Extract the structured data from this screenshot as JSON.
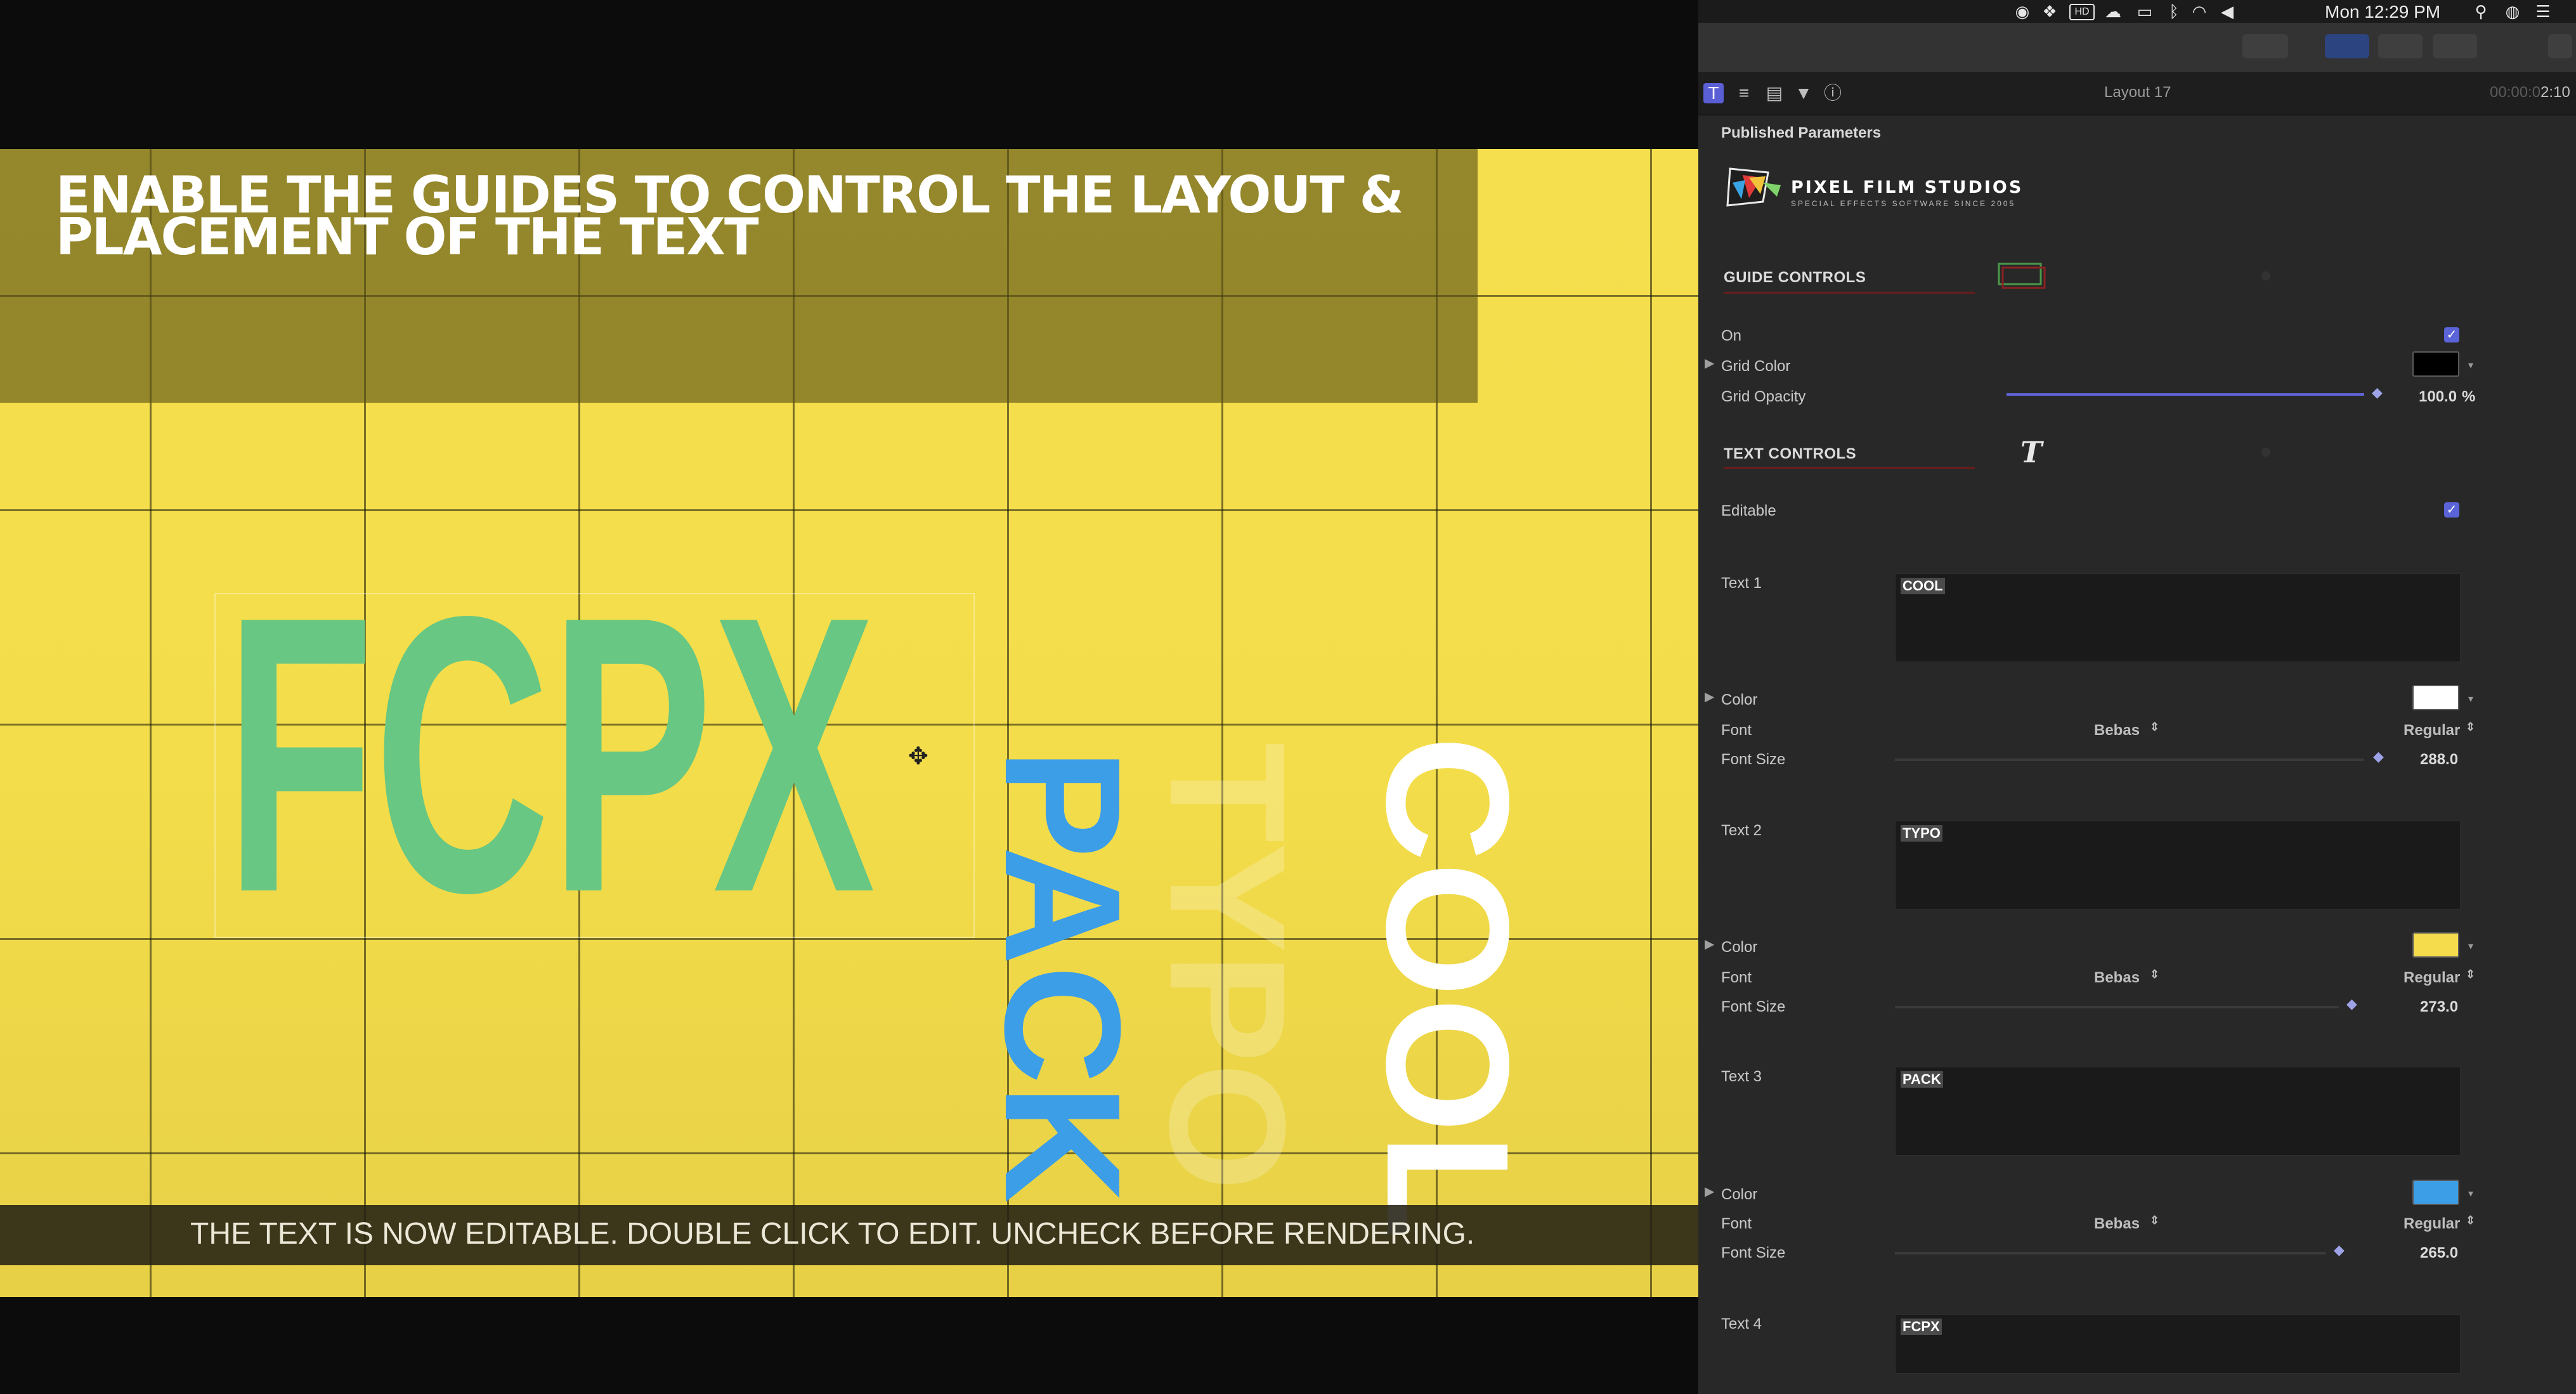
{
  "viewer": {
    "title": "ENABLE THE GUIDES TO CONTROL THE LAYOUT & PLACEMENT OF THE TEXT",
    "texts": {
      "fcpx": "FCPX",
      "pack": "PACK",
      "typo": "TYPO",
      "cool": "COOL"
    },
    "subtitle": "THE TEXT IS NOW EDITABLE. DOUBLE CLICK TO EDIT. UNCHECK BEFORE RENDERING."
  },
  "menubar": {
    "clock": "Mon 12:29 PM",
    "icons": [
      "record-icon",
      "dropbox-icon",
      "hd-icon",
      "creative-cloud-icon",
      "airplay-icon",
      "bluetooth-icon",
      "wifi-icon",
      "volume-icon",
      "search-icon",
      "siri-icon",
      "menu-list-icon"
    ]
  },
  "inspector": {
    "layout_title": "Layout 17",
    "timecode_dim": "00:00:0",
    "timecode_bright": "2:10",
    "published_params": "Published Parameters",
    "logo": {
      "name": "PIXEL FILM STUDIOS",
      "tagline": "SPECIAL EFFECTS SOFTWARE SINCE 2005"
    },
    "guide_controls": {
      "title": "GUIDE CONTROLS",
      "on_label": "On",
      "on_checked": true,
      "grid_color_label": "Grid Color",
      "grid_color": "#000000",
      "grid_opacity_label": "Grid Opacity",
      "grid_opacity_value": "100.0",
      "grid_opacity_unit": "%"
    },
    "text_controls": {
      "title": "TEXT CONTROLS",
      "editable_label": "Editable",
      "editable_checked": true
    },
    "text_params": [
      {
        "label": "Text 1",
        "value": "COOL",
        "color_label": "Color",
        "color": "#ffffff",
        "font_label": "Font",
        "font": "Bebas",
        "style": "Regular",
        "size_label": "Font Size",
        "size": "288.0"
      },
      {
        "label": "Text 2",
        "value": "TYPO",
        "color_label": "Color",
        "color": "#f4dc4c",
        "font_label": "Font",
        "font": "Bebas",
        "style": "Regular",
        "size_label": "Font Size",
        "size": "273.0"
      },
      {
        "label": "Text 3",
        "value": "PACK",
        "color_label": "Color",
        "color": "#3d9ee8",
        "font_label": "Font",
        "font": "Bebas",
        "style": "Regular",
        "size_label": "Font Size",
        "size": "265.0"
      },
      {
        "label": "Text 4",
        "value": "FCPX"
      }
    ]
  }
}
